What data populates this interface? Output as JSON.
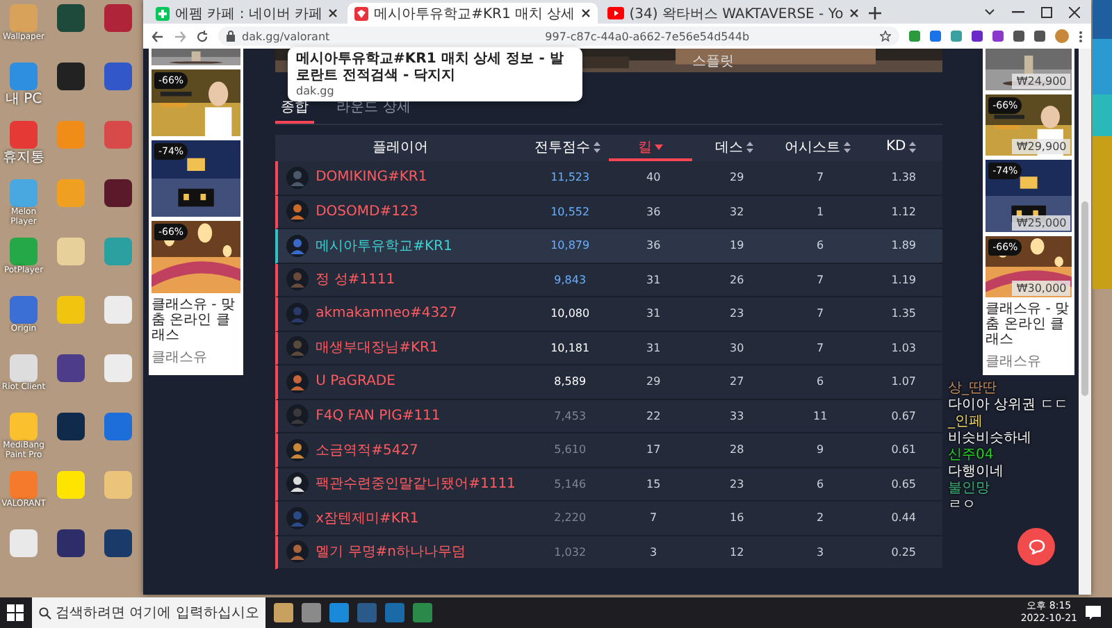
{
  "desktop_icons": [
    {
      "label": "Wallpaper"
    },
    {
      "label": "내 PC"
    },
    {
      "label": "휴지통"
    },
    {
      "label": "Melon Player"
    },
    {
      "label": "PotPlayer"
    },
    {
      "label": "Origin"
    },
    {
      "label": "Riot Client"
    },
    {
      "label": "MediBang Paint Pro"
    },
    {
      "label": "VALORANT"
    }
  ],
  "browser": {
    "tabs": [
      {
        "title": "에펨 카페 : 네이버 카페",
        "kind": "cafe",
        "selected": false
      },
      {
        "title": "메시아투유학교#KR1 매치 상세",
        "kind": "dak",
        "selected": true
      },
      {
        "title": "(34) 왁타버스 WAKTAVERSE - Yo",
        "kind": "video",
        "selected": false
      }
    ],
    "tooltip": {
      "title": "메시아투유학교#KR1 매치 상세 정보 - 발로란트 전적검색 - 닥지지",
      "domain": "dak.gg"
    },
    "url_start": "dak.gg/valorant",
    "url_end": "997-c87c-44a0-a662-7e56e54d544b"
  },
  "banner": {
    "label": "스플릿"
  },
  "result_tabs": [
    {
      "label": "종합",
      "selected": true
    },
    {
      "label": "라운드 상세",
      "selected": false
    }
  ],
  "table": {
    "columns": [
      {
        "label": "플레이어",
        "sortable": false,
        "selected": false
      },
      {
        "label": "전투점수",
        "sortable": true,
        "selected": false
      },
      {
        "label": "킬",
        "sortable": true,
        "selected": true
      },
      {
        "label": "데스",
        "sortable": true,
        "selected": false
      },
      {
        "label": "어시스트",
        "sortable": true,
        "selected": false
      },
      {
        "label": "KD",
        "sortable": true,
        "selected": false
      }
    ],
    "rows": [
      {
        "name": "DOMIKING#KR1",
        "score": {
          "text": "11,523",
          "color": "#6ab0ff"
        },
        "kills": "40",
        "deaths": "29",
        "assists": "7",
        "kd": "1.38",
        "selected": false
      },
      {
        "name": "DOSOMD#123",
        "score": {
          "text": "10,552",
          "color": "#6ab0ff"
        },
        "kills": "36",
        "deaths": "32",
        "assists": "1",
        "kd": "1.12",
        "selected": false
      },
      {
        "name": "메시아투유학교#KR1",
        "score": {
          "text": "10,879",
          "color": "#6ab0ff"
        },
        "kills": "36",
        "deaths": "19",
        "assists": "6",
        "kd": "1.89",
        "selected": true
      },
      {
        "name": "정 성#1111",
        "score": {
          "text": "9,843",
          "color": "#6ab0ff"
        },
        "kills": "31",
        "deaths": "26",
        "assists": "7",
        "kd": "1.19",
        "selected": false
      },
      {
        "name": "akmakamneo#4327",
        "score": {
          "text": "10,080",
          "color": "#ffffff"
        },
        "kills": "31",
        "deaths": "23",
        "assists": "7",
        "kd": "1.35",
        "selected": false
      },
      {
        "name": "매생부대장님#KR1",
        "score": {
          "text": "10,181",
          "color": "#ffffff"
        },
        "kills": "31",
        "deaths": "30",
        "assists": "7",
        "kd": "1.03",
        "selected": false
      },
      {
        "name": "U PaGRADE",
        "score": {
          "text": "8,589",
          "color": "#ffffff"
        },
        "kills": "29",
        "deaths": "27",
        "assists": "6",
        "kd": "1.07",
        "selected": false
      },
      {
        "name": "F4Q FAN PIG#111",
        "score": {
          "text": "7,453",
          "color": "#7d8596"
        },
        "kills": "22",
        "deaths": "33",
        "assists": "11",
        "kd": "0.67",
        "selected": false
      },
      {
        "name": "소금역적#5427",
        "score": {
          "text": "5,610",
          "color": "#7d8596"
        },
        "kills": "17",
        "deaths": "28",
        "assists": "9",
        "kd": "0.61",
        "selected": false
      },
      {
        "name": "팩관수련중인말같니됐어#1111",
        "score": {
          "text": "5,146",
          "color": "#7d8596"
        },
        "kills": "15",
        "deaths": "23",
        "assists": "6",
        "kd": "0.65",
        "selected": false
      },
      {
        "name": "x잠텐제미#KR1",
        "score": {
          "text": "2,220",
          "color": "#7d8596"
        },
        "kills": "7",
        "deaths": "16",
        "assists": "2",
        "kd": "0.44",
        "selected": false
      },
      {
        "name": "멜기 무명#n하나나무덤",
        "score": {
          "text": "1,032",
          "color": "#7d8596"
        },
        "kills": "3",
        "deaths": "12",
        "assists": "3",
        "kd": "0.25",
        "selected": false
      }
    ]
  },
  "left_ads": [
    {
      "kind": "picture"
    },
    {
      "discount": "-66%"
    },
    {
      "discount": "-74%"
    },
    {
      "discount": "-66%",
      "caption": "클래스유 - 맞춤 온라인 클래스",
      "advertiser": "클래스유"
    }
  ],
  "right_ads": [
    {
      "kind": "picture",
      "price": "₩24,900"
    },
    {
      "discount": "-66%",
      "price": "₩29,900"
    },
    {
      "discount": "-74%",
      "price": "₩25,000"
    },
    {
      "discount": "-66%",
      "price": "₩30,000",
      "caption": "클래스유 - 맞춤 온라인 클래스",
      "advertiser": "클래스유"
    }
  ],
  "chat": [
    {
      "user": "상_딴딴",
      "color": "#c08a60",
      "text": "다이아 상위권 ㄷㄷ"
    },
    {
      "user": "_인페",
      "color": "#f0d868",
      "text": "비슷비슷하네"
    },
    {
      "user": "신주04",
      "color": "#22d022",
      "text": "다행이네"
    },
    {
      "user": "불인망",
      "color": "#3fb07a",
      "text": "ㄹㅇ"
    }
  ],
  "taskbar": {
    "search_placeholder": "검색하려면 여기에 입력하십시오",
    "time": "오후 8:15",
    "date": "2022-10-21"
  }
}
